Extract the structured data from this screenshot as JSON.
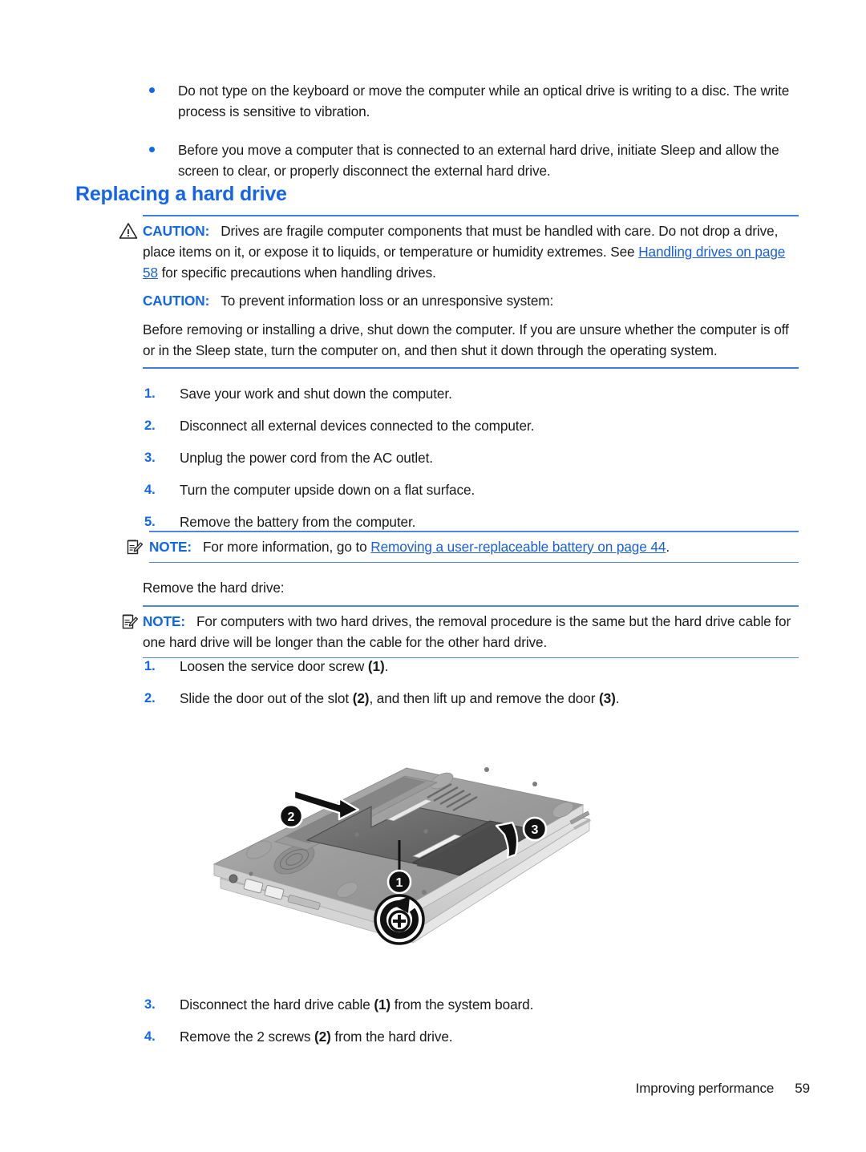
{
  "bullets": [
    "Do not type on the keyboard or move the computer while an optical drive is writing to a disc. The write process is sensitive to vibration.",
    "Before you move a computer that is connected to an external hard drive, initiate Sleep and allow the screen to clear, or properly disconnect the external hard drive."
  ],
  "heading": "Replacing a hard drive",
  "caution_handling": {
    "label": "CAUTION:",
    "icon": "warning-triangle-icon",
    "text_before_link": "Drives are fragile computer components that must be handled with care. Do not drop a drive, place items on it, or expose it to liquids, or temperature or humidity extremes. See ",
    "link": "Handling drives on page 58",
    "text_after_link": " for specific precautions when handling drives."
  },
  "caution_prevent": {
    "label": "CAUTION:",
    "text": "To prevent information loss or an unresponsive system:"
  },
  "shutdown_paragraph": "Before removing or installing a drive, shut down the computer. If you are unsure whether the computer is off or in the Sleep state, turn the computer on, and then shut it down through the operating system.",
  "steps_prepare": [
    {
      "n": "1.",
      "text": "Save your work and shut down the computer."
    },
    {
      "n": "2.",
      "text": "Disconnect all external devices connected to the computer."
    },
    {
      "n": "3.",
      "text": "Unplug the power cord from the AC outlet."
    },
    {
      "n": "4.",
      "text": "Turn the computer upside down on a flat surface."
    },
    {
      "n": "5.",
      "text": "Remove the battery from the computer."
    }
  ],
  "note_battery": {
    "label": "NOTE:",
    "icon": "notepad-pencil-icon",
    "text_before_link": "For more information, go to ",
    "link": "Removing a user-replaceable battery on page 44",
    "text_after_link": "."
  },
  "remove_hard_drive_label": "Remove the hard drive:",
  "note_twodrives": {
    "label": "NOTE:",
    "icon": "notepad-pencil-icon",
    "text": "For computers with two hard drives, the removal procedure is the same but the hard drive cable for one hard drive will be longer than the cable for the other hard drive."
  },
  "steps_remove": [
    {
      "n": "1.",
      "pre": "Loosen the service door screw ",
      "ref1": "(1)",
      "mid": "",
      "ref2": "",
      "post": "."
    },
    {
      "n": "2.",
      "pre": "Slide the door out of the slot ",
      "ref1": "(2)",
      "mid": ", and then lift up and remove the door ",
      "ref2": "(3)",
      "post": "."
    }
  ],
  "illustration": {
    "name": "laptop-bottom-service-door-diagram",
    "callouts": [
      "2",
      "3",
      "1"
    ],
    "screw_symbol": "loosen-screw-rotation-icon"
  },
  "steps_after": [
    {
      "n": "3.",
      "pre": "Disconnect the hard drive cable ",
      "ref1": "(1)",
      "post": " from the system board."
    },
    {
      "n": "4.",
      "pre": "Remove the 2 screws ",
      "ref1": "(2)",
      "post": " from the hard drive."
    }
  ],
  "footer": {
    "section": "Improving performance",
    "page": "59"
  },
  "colors": {
    "accent_blue": "#1166ee",
    "link_blue": "#1a5fd6",
    "heading_blue": "#1565ec",
    "rule_blue": "#3d7fe0"
  }
}
